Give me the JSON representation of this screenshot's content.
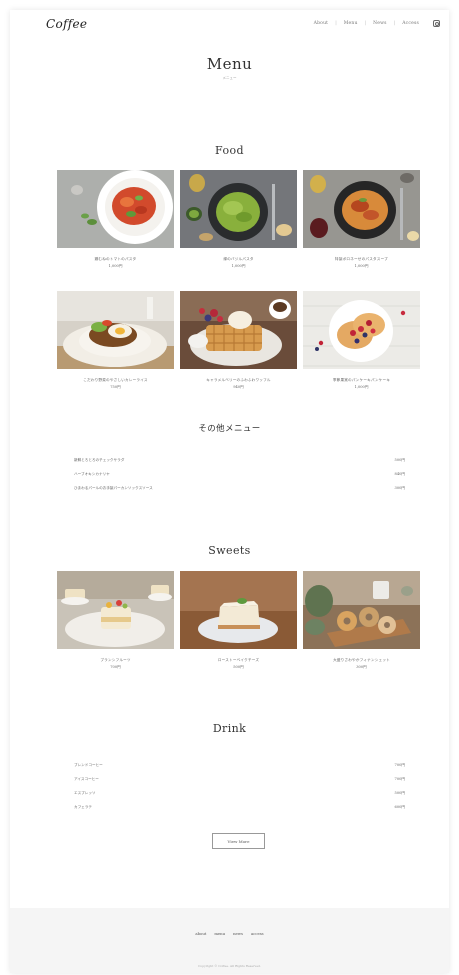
{
  "header": {
    "logo": "Coffee",
    "nav": [
      "About",
      "Menu",
      "News",
      "Access"
    ]
  },
  "page": {
    "title": "Menu",
    "subtitle": "メニュー"
  },
  "food": {
    "title": "Food",
    "items": [
      {
        "name": "鶏むねのトマトのパスタ",
        "price": "1,000円"
      },
      {
        "name": "緑のバジルパスタ",
        "price": "1,000円"
      },
      {
        "name": "特製ボロネーゼのパスタスープ",
        "price": "1,000円"
      },
      {
        "name": "こだわり野菜のやさしいカレーライス",
        "price": "750円"
      },
      {
        "name": "キャラメルベリーのふわふわワッフル",
        "price": "940円"
      },
      {
        "name": "季節果実のパンケーキパンケーキ",
        "price": "1,000円"
      }
    ]
  },
  "other_menu": {
    "title": "その他メニュー",
    "items": [
      {
        "name": "新鮮とろとろのチェックサラダ",
        "price": "500円"
      },
      {
        "name": "ハーブオキシカナリヤ",
        "price": "840円"
      },
      {
        "name": "ひまわるパールのお手製パーカンソックスソース",
        "price": "300円"
      }
    ]
  },
  "sweets": {
    "title": "Sweets",
    "items": [
      {
        "name": "ブランシフルーツ",
        "price": "700円"
      },
      {
        "name": "ローストーベイクチーズ",
        "price": "500円"
      },
      {
        "name": "大盛りさわやかフィナンシェット",
        "price": "300円"
      }
    ]
  },
  "drink": {
    "title": "Drink",
    "items": [
      {
        "name": "ブレンドコーヒー",
        "price": "700円"
      },
      {
        "name": "アイスコーヒー",
        "price": "700円"
      },
      {
        "name": "エスプレッソ",
        "price": "500円"
      },
      {
        "name": "カフェラテ",
        "price": "600円"
      }
    ],
    "view_more": "View More"
  },
  "footer": {
    "nav": [
      "about",
      "menu",
      "news",
      "access"
    ],
    "copyright": "Copyright © Coffee. All Rights Reserved."
  }
}
